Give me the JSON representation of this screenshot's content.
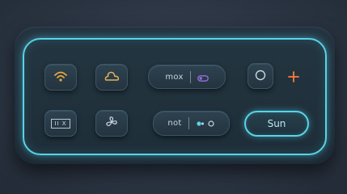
{
  "panel": {
    "mox_label": "mox",
    "not_label": "not",
    "sun_label": "Sun",
    "box_text": "II X"
  },
  "icons": {
    "wifi": "wifi-icon",
    "cloud": "cloud-icon",
    "toggle": "toggle-icon",
    "circle": "circle-icon",
    "plus": "plus-icon",
    "box": "box-icon",
    "fan": "fan-icon",
    "dots": "dot-indicator-icon"
  },
  "colors": {
    "accent_glow": "#57d4e8",
    "wifi": "#e9a83a",
    "cloud": "#e0b25a",
    "toggle": "#9a6de0",
    "plus": "#ff7a3c"
  }
}
